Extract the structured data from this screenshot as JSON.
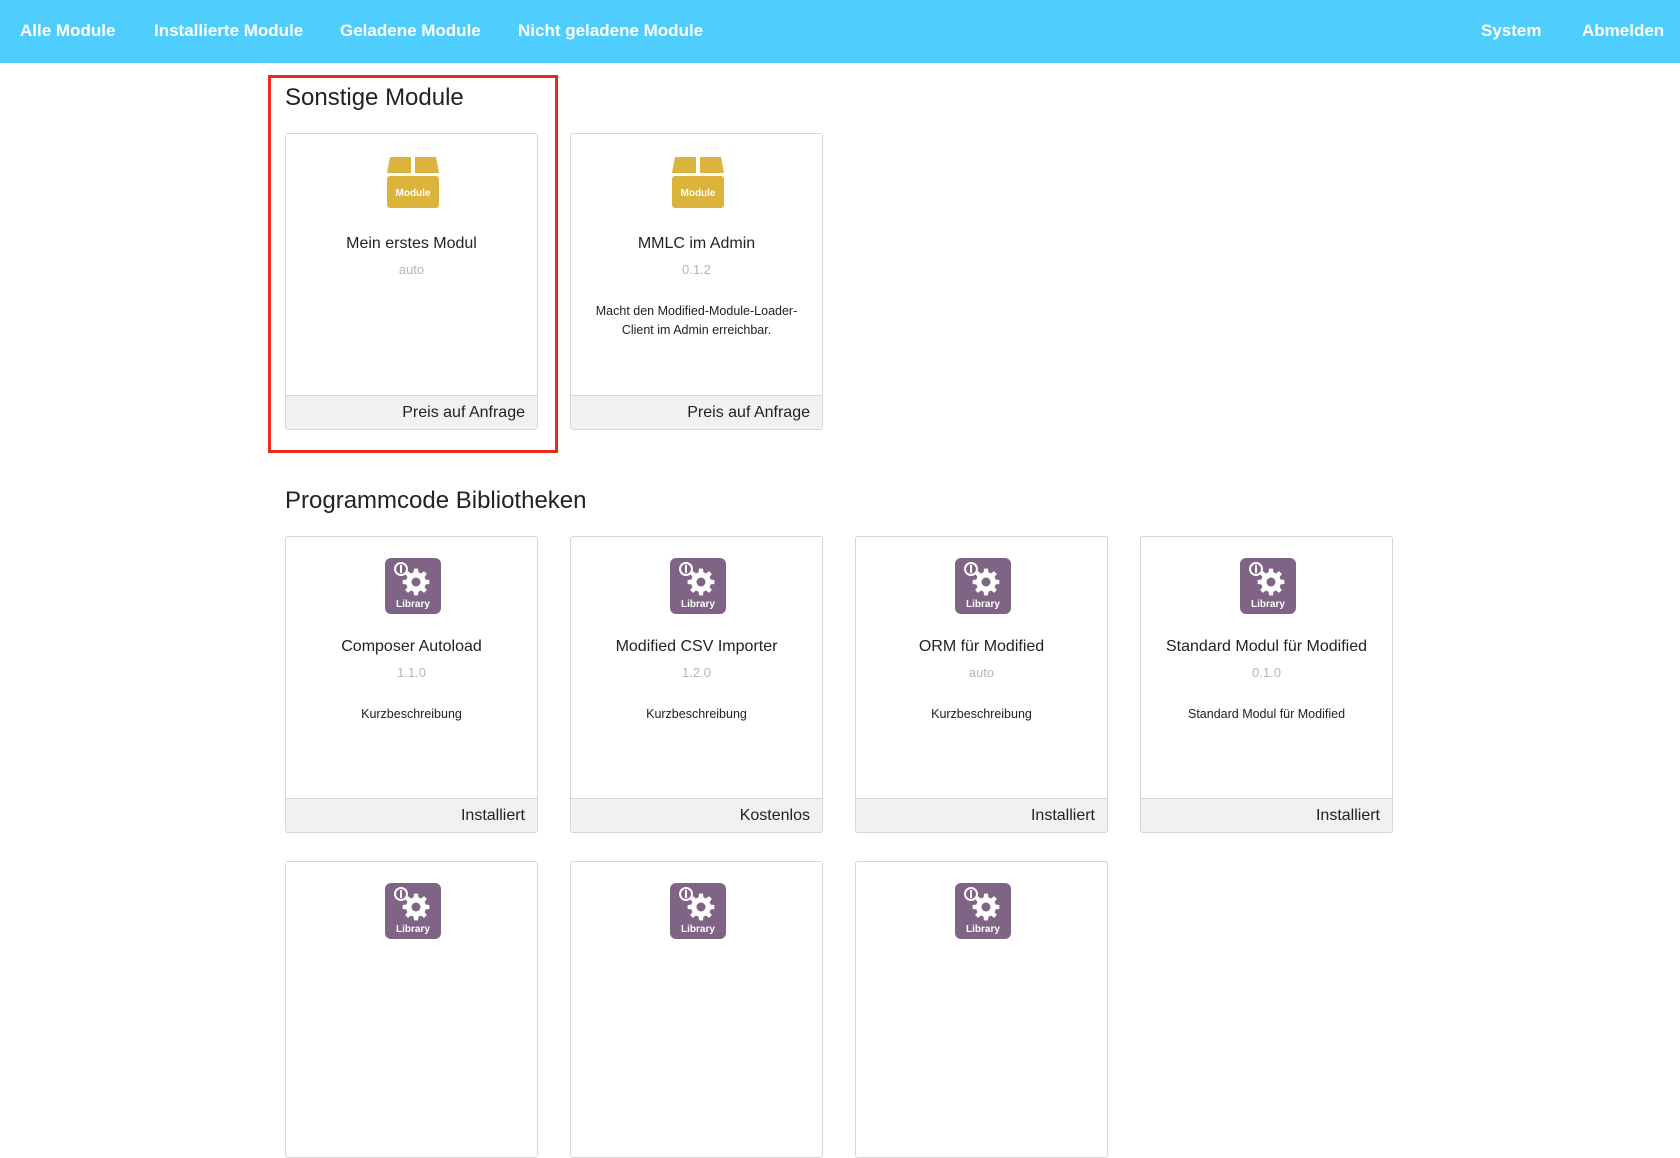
{
  "nav": {
    "left": [
      "Alle Module",
      "Installierte Module",
      "Geladene Module",
      "Nicht geladene Module"
    ],
    "right": [
      "System",
      "Abmelden"
    ]
  },
  "sections": [
    {
      "title": "Sonstige Module",
      "cards": [
        {
          "name": "Mein erstes Modul",
          "version": "auto",
          "description": "",
          "price": "Preis auf Anfrage",
          "icon": "module-box-icon",
          "icon_label": "Module"
        },
        {
          "name": "MMLC im Admin",
          "version": "0.1.2",
          "description": "Macht den Modified-Module-Loader-Client im Admin erreichbar.",
          "price": "Preis auf Anfrage",
          "icon": "module-box-icon",
          "icon_label": "Module"
        }
      ]
    },
    {
      "title": "Programmcode Bibliotheken",
      "cards": [
        {
          "name": "Composer Autoload",
          "version": "1.1.0",
          "description": "Kurzbeschreibung",
          "price": "Installiert",
          "icon": "library-gear-icon",
          "icon_label": "Library"
        },
        {
          "name": "Modified CSV Importer",
          "version": "1.2.0",
          "description": "Kurzbeschreibung",
          "price": "Kostenlos",
          "icon": "library-gear-icon",
          "icon_label": "Library"
        },
        {
          "name": "ORM für Modified",
          "version": "auto",
          "description": "Kurzbeschreibung",
          "price": "Installiert",
          "icon": "library-gear-icon",
          "icon_label": "Library"
        },
        {
          "name": "Standard Modul für Modified",
          "version": "0.1.0",
          "description": "Standard Modul für Modified",
          "price": "Installiert",
          "icon": "library-gear-icon",
          "icon_label": "Library"
        },
        {
          "name": "",
          "version": "",
          "description": "",
          "price": "",
          "icon": "library-gear-icon",
          "icon_label": "Library"
        },
        {
          "name": "",
          "version": "",
          "description": "",
          "price": "",
          "icon": "library-gear-icon",
          "icon_label": "Library"
        },
        {
          "name": "",
          "version": "",
          "description": "",
          "price": "",
          "icon": "library-gear-icon",
          "icon_label": "Library"
        }
      ]
    }
  ],
  "colors": {
    "navbar": "#4fcdfd",
    "module_icon": "#dcb43c",
    "library_icon": "#7f6486",
    "highlight": "#e8291c"
  }
}
